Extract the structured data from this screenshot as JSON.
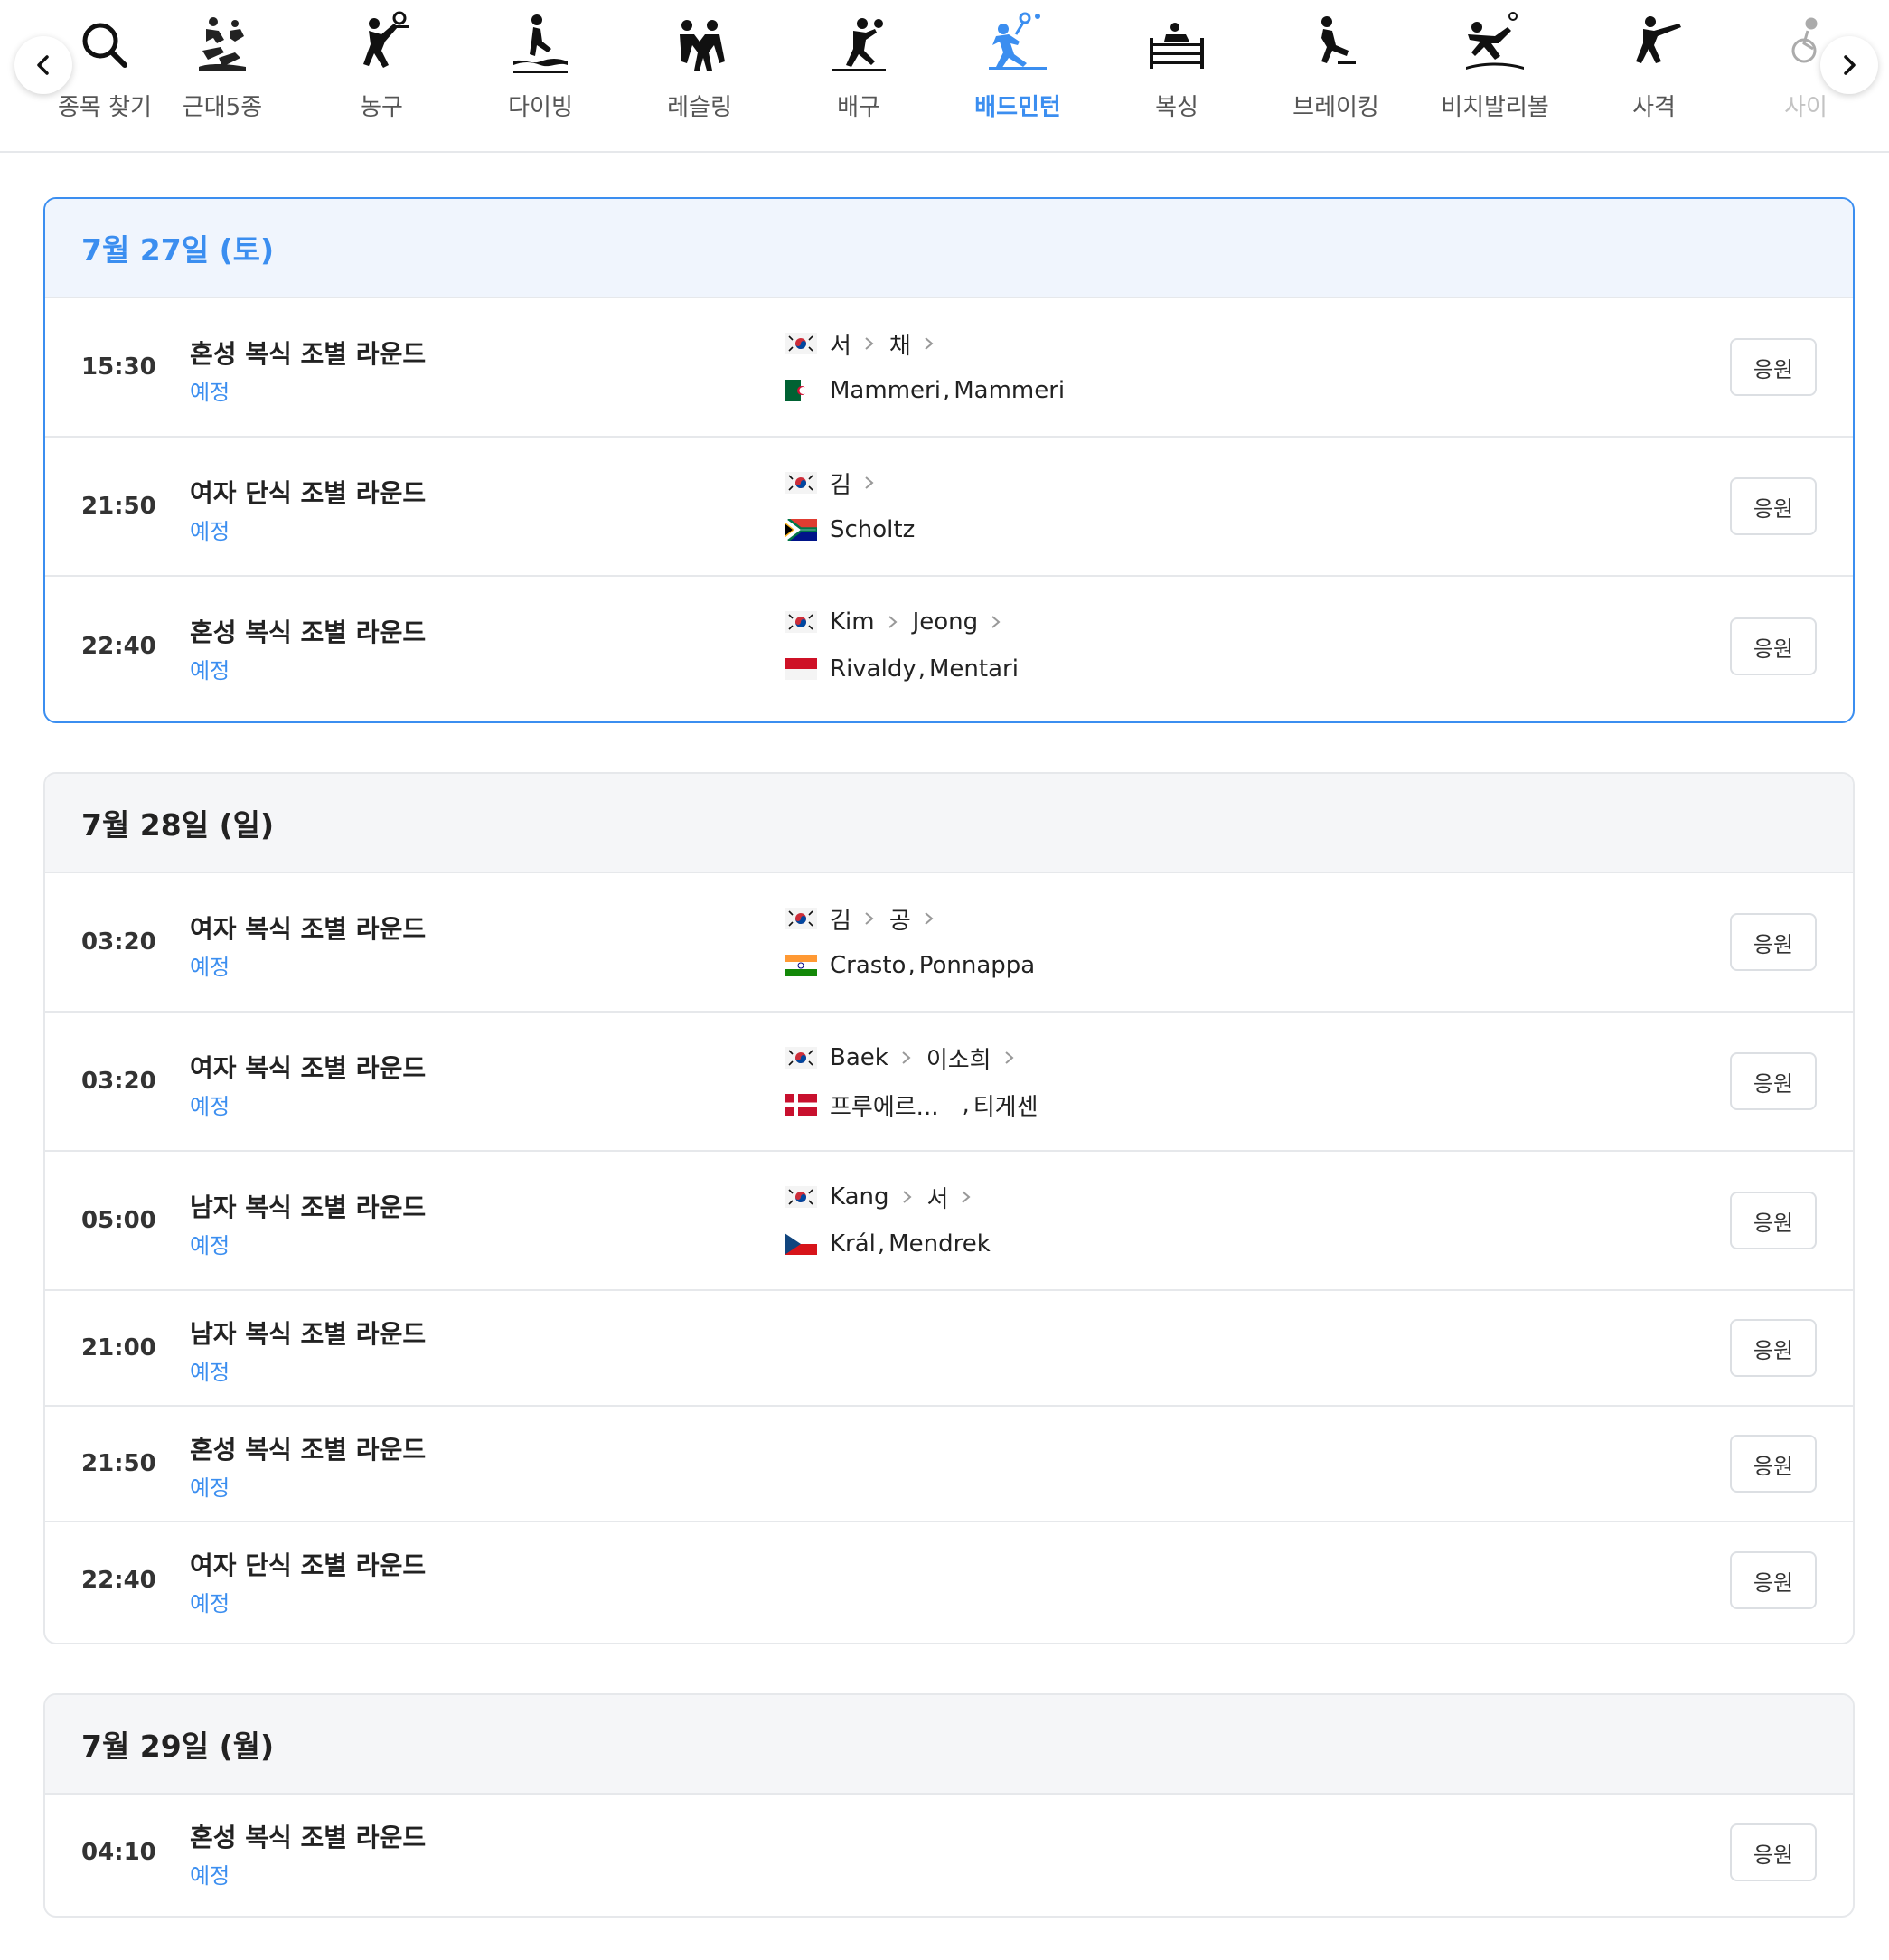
{
  "nav": {
    "prev_label": "이전",
    "next_label": "다음",
    "active_color": "#3b8ef0",
    "items": [
      {
        "label": "종목 찾기",
        "icon": "search-icon"
      },
      {
        "label": "근대5종",
        "icon": "modern-pentathlon-icon"
      },
      {
        "label": "농구",
        "icon": "basketball-icon"
      },
      {
        "label": "다이빙",
        "icon": "diving-icon"
      },
      {
        "label": "레슬링",
        "icon": "wrestling-icon"
      },
      {
        "label": "배구",
        "icon": "volleyball-icon"
      },
      {
        "label": "배드민턴",
        "icon": "badminton-icon"
      },
      {
        "label": "복싱",
        "icon": "boxing-icon"
      },
      {
        "label": "브레이킹",
        "icon": "breaking-icon"
      },
      {
        "label": "비치발리볼",
        "icon": "beach-volleyball-icon"
      },
      {
        "label": "사격",
        "icon": "shooting-icon"
      },
      {
        "label": "사이",
        "icon": "cycling-icon"
      }
    ]
  },
  "days": [
    {
      "date": "7월 27일 (토)",
      "matches": [
        {
          "time": "15:30",
          "event": "혼성 복식 조별 라운드",
          "status": "예정",
          "team1": {
            "flag": "kr",
            "players": [
              "서",
              "채"
            ]
          },
          "team2": {
            "flag": "dz",
            "players": [
              "Mammeri",
              "Mammeri"
            ]
          },
          "cheer": "응원"
        },
        {
          "time": "21:50",
          "event": "여자 단식 조별 라운드",
          "status": "예정",
          "team1": {
            "flag": "kr",
            "players": [
              "김"
            ]
          },
          "team2": {
            "flag": "za",
            "players": [
              "Scholtz"
            ]
          },
          "cheer": "응원"
        },
        {
          "time": "22:40",
          "event": "혼성 복식 조별 라운드",
          "status": "예정",
          "team1": {
            "flag": "kr",
            "players": [
              "Kim",
              "Jeong"
            ]
          },
          "team2": {
            "flag": "id",
            "players": [
              "Rivaldy",
              "Mentari"
            ]
          },
          "cheer": "응원"
        }
      ]
    },
    {
      "date": "7월 28일 (일)",
      "matches": [
        {
          "time": "03:20",
          "event": "여자 복식 조별 라운드",
          "status": "예정",
          "team1": {
            "flag": "kr",
            "players": [
              "김",
              "공"
            ]
          },
          "team2": {
            "flag": "in",
            "players": [
              "Crasto",
              "Ponnappa"
            ]
          },
          "cheer": "응원"
        },
        {
          "time": "03:20",
          "event": "여자 복식 조별 라운드",
          "status": "예정",
          "team1": {
            "flag": "kr",
            "players": [
              "Baek",
              "이소희"
            ]
          },
          "team2": {
            "flag": "dk",
            "players": [
              "프루에르...",
              "티게센"
            ]
          },
          "cheer": "응원"
        },
        {
          "time": "05:00",
          "event": "남자 복식 조별 라운드",
          "status": "예정",
          "team1": {
            "flag": "kr",
            "players": [
              "Kang",
              "서"
            ]
          },
          "team2": {
            "flag": "cz",
            "players": [
              "Král",
              "Mendrek"
            ]
          },
          "cheer": "응원"
        },
        {
          "time": "21:00",
          "event": "남자 복식 조별 라운드",
          "status": "예정",
          "cheer": "응원"
        },
        {
          "time": "21:50",
          "event": "혼성 복식 조별 라운드",
          "status": "예정",
          "cheer": "응원"
        },
        {
          "time": "22:40",
          "event": "여자 단식 조별 라운드",
          "status": "예정",
          "cheer": "응원"
        }
      ]
    },
    {
      "date": "7월 29일 (월)",
      "matches": [
        {
          "time": "04:10",
          "event": "혼성 복식 조별 라운드",
          "status": "예정",
          "cheer": "응원"
        }
      ]
    }
  ]
}
